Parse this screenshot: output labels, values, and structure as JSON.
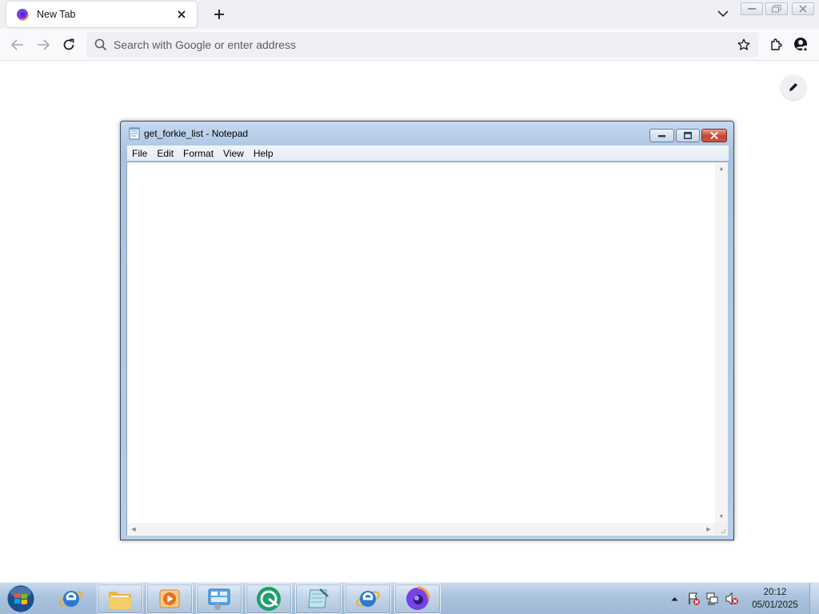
{
  "browser": {
    "tab": {
      "title": "New Tab"
    },
    "urlbar": {
      "placeholder": "Search with Google or enter address",
      "value": ""
    },
    "icons": {
      "back": "back-arrow-icon",
      "forward": "forward-arrow-icon",
      "reload": "reload-icon",
      "bookmark": "star-icon",
      "extensions": "puzzle-icon",
      "account": "account-icon",
      "customize": "pencil-icon"
    },
    "colors": {
      "toolbar": "#f9f9fb",
      "tabstrip": "#f0f0f4",
      "urlbar": "#f0f0f4"
    }
  },
  "notepad": {
    "title": "get_forkie_list - Notepad",
    "menu": [
      "File",
      "Edit",
      "Format",
      "View",
      "Help"
    ],
    "content": "",
    "colors": {
      "close_button": "#c6452f"
    }
  },
  "taskbar": {
    "apps": [
      {
        "name": "internet-explorer",
        "running": false
      },
      {
        "name": "file-explorer",
        "running": true
      },
      {
        "name": "media-player",
        "running": true
      },
      {
        "name": "control-panel",
        "running": true
      },
      {
        "name": "green-app",
        "running": true
      },
      {
        "name": "notepad",
        "running": true
      },
      {
        "name": "internet-explorer",
        "running": true
      },
      {
        "name": "firefox",
        "running": true
      }
    ],
    "tray": [
      "show-hidden-icons",
      "action-center-icon",
      "network-icon",
      "volume-muted-icon"
    ],
    "clock": {
      "time": "20:12",
      "date": "05/01/2025"
    }
  }
}
